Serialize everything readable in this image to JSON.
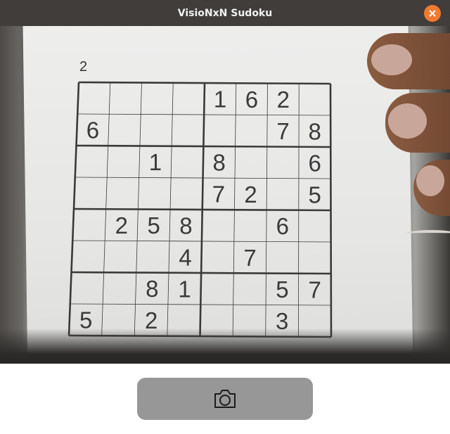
{
  "window": {
    "title": "VisioNxN Sudoku",
    "close_icon": "close-icon",
    "close_color": "#f07a30"
  },
  "camera": {
    "puzzle_label": "2",
    "grid": [
      [
        "",
        "",
        "",
        "",
        "1",
        "6",
        "2",
        ""
      ],
      [
        "6",
        "",
        "",
        "",
        "",
        "",
        "7",
        "8"
      ],
      [
        "",
        "",
        "1",
        "",
        "8",
        "",
        "",
        "6"
      ],
      [
        "",
        "",
        "",
        "",
        "7",
        "2",
        "",
        "5"
      ],
      [
        "",
        "2",
        "5",
        "8",
        "",
        "",
        "6",
        ""
      ],
      [
        "",
        "",
        "",
        "4",
        "",
        "7",
        "",
        ""
      ],
      [
        "",
        "",
        "8",
        "1",
        "",
        "",
        "5",
        "7"
      ],
      [
        "5",
        "",
        "2",
        "",
        "",
        "",
        "3",
        ""
      ]
    ]
  },
  "capture_button": {
    "icon": "camera-icon",
    "color": "#979797"
  }
}
